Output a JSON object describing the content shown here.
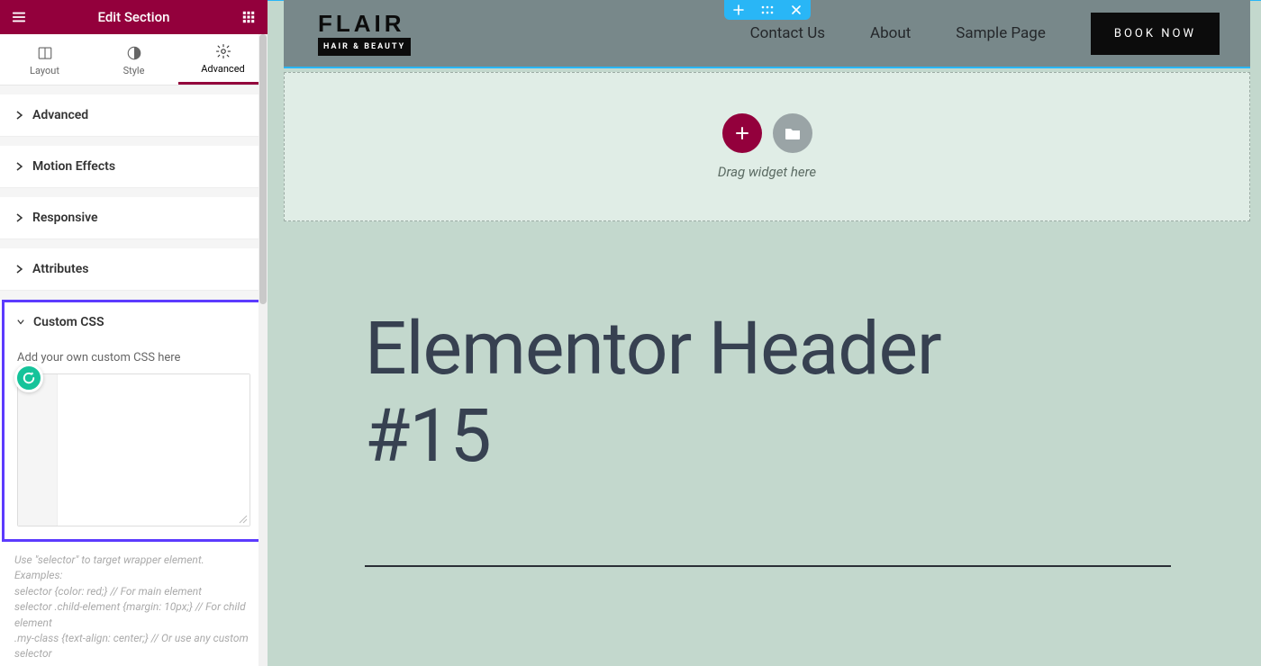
{
  "sidebar": {
    "title": "Edit Section",
    "tabs": [
      {
        "label": "Layout",
        "active": false
      },
      {
        "label": "Style",
        "active": false
      },
      {
        "label": "Advanced",
        "active": true
      }
    ],
    "panels": {
      "advanced": "Advanced",
      "motion": "Motion Effects",
      "responsive": "Responsive",
      "attributes": "Attributes",
      "custom_css": "Custom CSS"
    },
    "custom_css": {
      "label": "Add your own custom CSS here",
      "value": "",
      "hint": "Use \"selector\" to target wrapper element.\nExamples:\nselector {color: red;} // For main element\nselector .child-element {margin: 10px;} // For child element\n.my-class {text-align: center;} // Or use any custom selector"
    }
  },
  "preview": {
    "logo": {
      "main": "FLAIR",
      "sub": "HAIR & BEAUTY"
    },
    "nav": [
      "Contact Us",
      "About",
      "Sample Page"
    ],
    "cta": "BOOK NOW",
    "dropzone_text": "Drag widget here",
    "hero_title": "Elementor Header #15"
  },
  "colors": {
    "brand": "#93003C",
    "highlight": "#5C3BFE",
    "selection": "#29B6F6",
    "preview_bg": "#C3D8CD"
  }
}
